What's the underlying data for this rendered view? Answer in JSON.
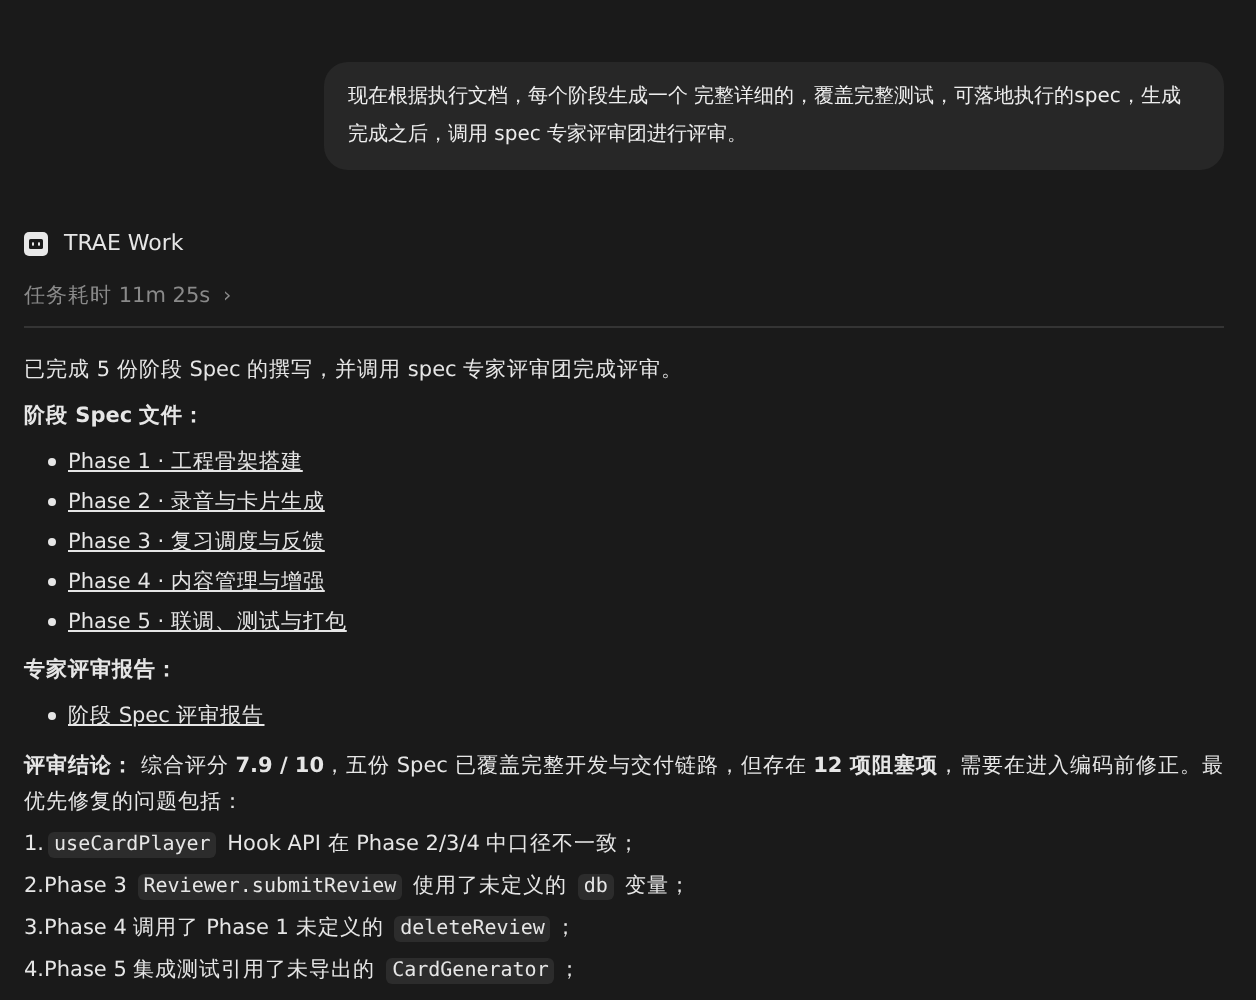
{
  "user_message": "现在根据执行文档，每个阶段生成一个 完整详细的，覆盖完整测试，可落地执行的spec，生成完成之后，调用 spec 专家评审团进行评审。",
  "agent": {
    "name": "TRAE Work",
    "duration": "任务耗时 11m 25s",
    "chevron": "›"
  },
  "summary": "已完成 5 份阶段 Spec 的撰写，并调用 spec 专家评审团完成评审。",
  "spec_heading": "阶段 Spec 文件：",
  "spec_links": [
    "Phase 1 · 工程骨架搭建",
    "Phase 2 · 录音与卡片生成",
    "Phase 3 · 复习调度与反馈",
    "Phase 4 · 内容管理与增强",
    "Phase 5 · 联调、测试与打包"
  ],
  "report_heading": "专家评审报告：",
  "report_links": [
    "阶段 Spec 评审报告"
  ],
  "conclusion": "**评审结论：** 综合评分 **7.9 / 10**，五份 Spec 已覆盖完整开发与交付链路，但存在 **12 项阻塞项**，需要在进入编码前修正。最优先修复的问题包括：",
  "issues": [
    {
      "number": "1.",
      "parts": [
        {
          "kind": "code",
          "text": "useCardPlayer"
        },
        {
          "kind": "text",
          "text": " Hook API 在 Phase 2/3/4 中口径不一致；"
        }
      ]
    },
    {
      "number": "2.",
      "parts": [
        {
          "kind": "text",
          "text": "Phase 3 "
        },
        {
          "kind": "code",
          "text": "Reviewer.submitReview"
        },
        {
          "kind": "text",
          "text": " 使用了未定义的 "
        },
        {
          "kind": "code",
          "text": "db"
        },
        {
          "kind": "text",
          "text": " 变量；"
        }
      ]
    },
    {
      "number": "3.",
      "parts": [
        {
          "kind": "text",
          "text": "Phase 4 调用了 Phase 1 未定义的 "
        },
        {
          "kind": "code",
          "text": "deleteReview"
        },
        {
          "kind": "text",
          "text": "；"
        }
      ]
    },
    {
      "number": "4.",
      "parts": [
        {
          "kind": "text",
          "text": "Phase 5 集成测试引用了未导出的 "
        },
        {
          "kind": "code",
          "text": "CardGenerator"
        },
        {
          "kind": "text",
          "text": "；"
        }
      ]
    }
  ]
}
